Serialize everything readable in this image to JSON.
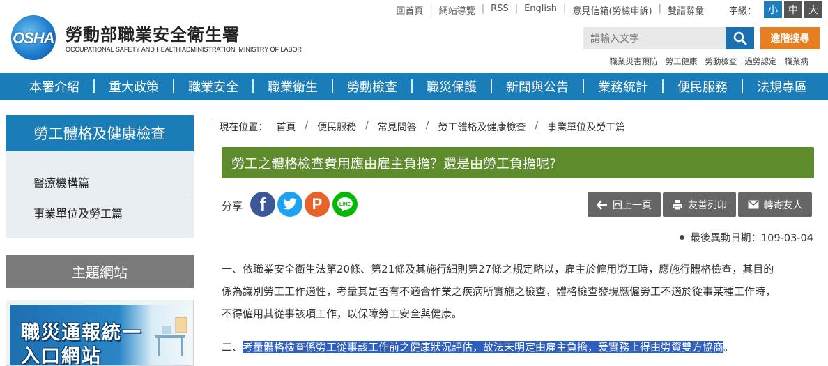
{
  "header": {
    "logo_text": "OSHA",
    "org_name": "勞動部職業安全衛生署",
    "org_name_en": "OCCUPATIONAL SAFETY AND HEALTH ADMINISTRATION, MINISTRY OF LABOR",
    "top_links": [
      "回首頁",
      "網站導覽",
      "RSS",
      "English",
      "意見信箱(勞檢申訴)",
      "雙語辭彙"
    ],
    "font_size_label": "字級：",
    "font_sizes": [
      "小",
      "中",
      "大"
    ],
    "search_placeholder": "請輸入文字",
    "advanced_search": "進階搜尋",
    "quick_links": [
      "職業災害預防",
      "勞工健康",
      "勞動檢查",
      "過勞認定",
      "職業病"
    ]
  },
  "main_nav": [
    "本署介紹",
    "重大政策",
    "職業安全",
    "職業衛生",
    "勞動檢查",
    "職災保護",
    "新聞與公告",
    "業務統計",
    "便民服務",
    "法規專區"
  ],
  "sidebar": {
    "title": "勞工體格及健康檢查",
    "items": [
      "醫療機構篇",
      "事業單位及勞工篇"
    ],
    "theme_title": "主題網站",
    "banner_line1": "職災通報統一",
    "banner_line2": "入口網站"
  },
  "breadcrumb": {
    "label": "現在位置：",
    "items": [
      "首頁",
      "便民服務",
      "常見問答",
      "勞工體格及健康檢查",
      "事業單位及勞工篇"
    ]
  },
  "page_title": "勞工之體格檢查費用應由雇主負擔？還是由勞工負擔呢?",
  "share": {
    "label": "分享",
    "icons": [
      "facebook-icon",
      "twitter-icon",
      "plurk-icon",
      "line-icon"
    ]
  },
  "actions": {
    "back": "回上一頁",
    "print": "友善列印",
    "forward": "轉寄友人"
  },
  "last_update": "最後異動日期：109-03-04",
  "content": {
    "p1_line1": "一、依職業安全衛生法第20條、第21條及其施行細則第27條之規定略以，雇主於僱用勞工時，應施行體格檢查，其目的",
    "p1_line2": "係為識別勞工工作適性，考量其是否有不適合作業之疾病所實施之檢查，體格檢查發現應僱勞工不適於從事某種工作時，",
    "p1_line3": "不得僱用其從事該項工作，以保障勞工安全與健康。",
    "p2_prefix": "二、",
    "p2_highlight": "考量體格檢查係勞工從事該工作前之健康狀況評估，故法未明定由雇主負擔，爰實務上得由勞資雙方協商",
    "p2_suffix": "。"
  },
  "colors": {
    "primary_blue": "#1b7db8",
    "title_green": "#5e8c2d",
    "accent_orange": "#e67e22",
    "highlight": "#2f5fbf"
  }
}
